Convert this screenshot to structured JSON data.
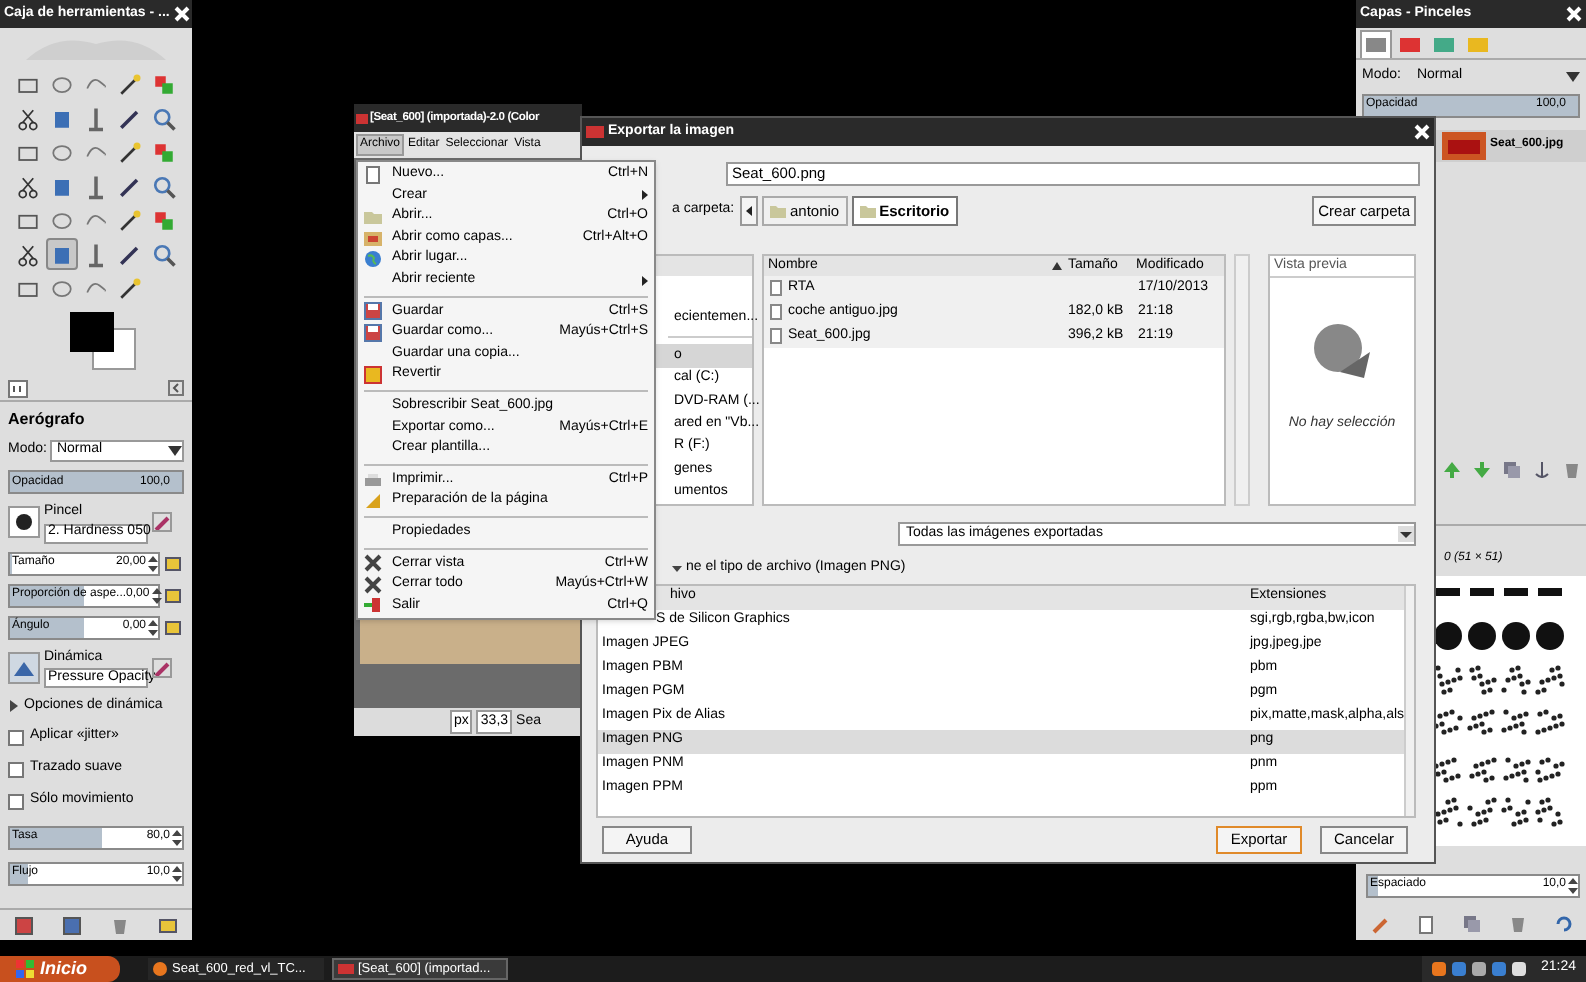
{
  "toolbox": {
    "title": "Caja de herramientas - ...",
    "tools": [
      {
        "selected": false
      },
      {
        "selected": false
      },
      {
        "selected": false
      },
      {
        "selected": false
      },
      {
        "selected": false
      },
      {
        "selected": false
      },
      {
        "selected": false
      },
      {
        "selected": false
      },
      {
        "selected": false
      },
      {
        "selected": false
      },
      {
        "selected": false
      },
      {
        "selected": false
      },
      {
        "selected": false
      },
      {
        "selected": false
      },
      {
        "selected": false
      },
      {
        "selected": false
      },
      {
        "selected": false
      },
      {
        "selected": false
      },
      {
        "selected": false
      },
      {
        "selected": false
      },
      {
        "selected": false
      },
      {
        "selected": false
      },
      {
        "selected": false
      },
      {
        "selected": false
      },
      {
        "selected": false
      },
      {
        "selected": false
      },
      {
        "selected": true
      },
      {
        "selected": false
      },
      {
        "selected": false
      },
      {
        "selected": false
      },
      {
        "selected": false
      },
      {
        "selected": false
      },
      {
        "selected": false
      },
      {
        "selected": false
      }
    ],
    "options": {
      "title": "Aerógrafo",
      "mode": {
        "label": "Modo:",
        "value": "Normal"
      },
      "opacity": {
        "label": "Opacidad",
        "value": "100,0",
        "level": 1
      },
      "brush": {
        "label": "Pincel",
        "value": "2. Hardness 050"
      },
      "params": [
        {
          "label": "Tamaño",
          "value": "20,00",
          "level": 0.02
        },
        {
          "label": "Proporción de aspe...",
          "value": "0,00",
          "level": 0.5
        },
        {
          "label": "Ángulo",
          "value": "0,00",
          "level": 0.5
        }
      ],
      "dynamics": {
        "label": "Dinámica",
        "value": "Pressure Opacity"
      },
      "dynamics_options": {
        "label": "Opciones de dinámica",
        "expanded": false
      },
      "checkboxes": [
        {
          "label": "Aplicar «jitter»",
          "checked": false
        },
        {
          "label": "Trazado suave",
          "checked": false
        },
        {
          "label": "Sólo movimiento",
          "checked": false
        }
      ],
      "rates": [
        {
          "label": "Tasa",
          "value": "80,0",
          "level": 0.53
        },
        {
          "label": "Flujo",
          "value": "10,0",
          "level": 0.1
        }
      ]
    }
  },
  "image_window": {
    "title": "[Seat_600] (importada)-2.0 (Color",
    "menus": [
      {
        "label": "Archivo",
        "selected": true
      },
      {
        "label": "Editar",
        "selected": false
      },
      {
        "label": "Seleccionar",
        "selected": false
      },
      {
        "label": "Vista",
        "selected": false
      }
    ],
    "unit": "px",
    "zoom": "33,3",
    "status": "Sea"
  },
  "file_menu": [
    {
      "kind": "item",
      "label": "Nuevo...",
      "shortcut": "Ctrl+N"
    },
    {
      "kind": "item",
      "label": "Crear",
      "submenu": true
    },
    {
      "kind": "item",
      "label": "Abrir...",
      "shortcut": "Ctrl+O"
    },
    {
      "kind": "item",
      "label": "Abrir como capas...",
      "shortcut": "Ctrl+Alt+O"
    },
    {
      "kind": "item",
      "label": "Abrir lugar..."
    },
    {
      "kind": "item",
      "label": "Abrir reciente",
      "submenu": true
    },
    {
      "kind": "separator"
    },
    {
      "kind": "item",
      "label": "Guardar",
      "shortcut": "Ctrl+S"
    },
    {
      "kind": "item",
      "label": "Guardar como...",
      "shortcut": "Mayús+Ctrl+S"
    },
    {
      "kind": "item",
      "label": "Guardar una copia..."
    },
    {
      "kind": "item",
      "label": "Revertir"
    },
    {
      "kind": "separator"
    },
    {
      "kind": "item",
      "label": "Sobrescribir Seat_600.jpg"
    },
    {
      "kind": "item",
      "label": "Exportar como...",
      "shortcut": "Mayús+Ctrl+E"
    },
    {
      "kind": "item",
      "label": "Crear plantilla..."
    },
    {
      "kind": "separator"
    },
    {
      "kind": "item",
      "label": "Imprimir...",
      "shortcut": "Ctrl+P"
    },
    {
      "kind": "item",
      "label": "Preparación de la página"
    },
    {
      "kind": "separator"
    },
    {
      "kind": "item",
      "label": "Propiedades"
    },
    {
      "kind": "separator"
    },
    {
      "kind": "item",
      "label": "Cerrar vista",
      "shortcut": "Ctrl+W"
    },
    {
      "kind": "item",
      "label": "Cerrar todo",
      "shortcut": "Mayús+Ctrl+W"
    },
    {
      "kind": "item",
      "label": "Salir",
      "shortcut": "Ctrl+Q"
    }
  ],
  "export_dialog": {
    "title": "Exportar la imagen",
    "name_value": "Seat_600.png",
    "folder_label": "a carpeta:",
    "path": [
      {
        "label": "antonio",
        "selected": false
      },
      {
        "label": "Escritorio",
        "selected": true
      }
    ],
    "create_folder": "Crear carpeta",
    "places": [
      {
        "label": "ecientemen...",
        "selected": false
      },
      {
        "label": "o",
        "selected": true
      },
      {
        "label": "cal (C:)",
        "selected": false
      },
      {
        "label": "DVD-RAM (...",
        "selected": false
      },
      {
        "label": "ared en \"Vb...",
        "selected": false
      },
      {
        "label": "R (F:)",
        "selected": false
      },
      {
        "label": "genes",
        "selected": false
      },
      {
        "label": "umentos",
        "selected": false
      }
    ],
    "file_columns": [
      "Nombre",
      "Tamaño",
      "Modificado"
    ],
    "files": [
      {
        "name": "RTA",
        "modified": "17/10/2013"
      },
      {
        "name": "coche antiguo.jpg",
        "size": "182,0 kB",
        "modified": "21:18"
      },
      {
        "name": "Seat_600.jpg",
        "size": "396,2 kB",
        "modified": "21:19"
      }
    ],
    "preview_label": "Vista previa",
    "preview_empty": "No hay selección",
    "filter": "Todas las imágenes exportadas",
    "type_expander": {
      "label": "ne el tipo de archivo (Imagen PNG)",
      "expanded": true
    },
    "type_columns": [
      "hivo",
      "Extensiones"
    ],
    "types": [
      {
        "name": "S de Silicon Graphics",
        "ext": "sgi,rgb,rgba,bw,icon",
        "selected": false
      },
      {
        "name": "Imagen JPEG",
        "ext": "jpg,jpeg,jpe",
        "selected": false
      },
      {
        "name": "Imagen PBM",
        "ext": "pbm",
        "selected": false
      },
      {
        "name": "Imagen PGM",
        "ext": "pgm",
        "selected": false
      },
      {
        "name": "Imagen Pix de Alias",
        "ext": "pix,matte,mask,alpha,als",
        "selected": false
      },
      {
        "name": "Imagen PNG",
        "ext": "png",
        "selected": true
      },
      {
        "name": "Imagen PNM",
        "ext": "pnm",
        "selected": false
      },
      {
        "name": "Imagen PPM",
        "ext": "ppm",
        "selected": false
      }
    ],
    "help": "Ayuda",
    "export": "Exportar",
    "cancel": "Cancelar"
  },
  "right_panel": {
    "title": "Capas - Pinceles",
    "tabs": [
      {
        "selected": true
      },
      {
        "selected": false
      },
      {
        "selected": false
      },
      {
        "selected": false
      }
    ],
    "mode": {
      "label": "Modo:",
      "value": "Normal"
    },
    "opacity": {
      "label": "Opacidad",
      "value": "100,0",
      "level": 1
    },
    "layers": [
      {
        "name": "Seat_600.jpg"
      }
    ],
    "brush_info": "0 (51 × 51)",
    "spacing": {
      "label": "Espaciado",
      "value": "10,0",
      "level": 0.05
    }
  },
  "taskbar": {
    "start": "Inicio",
    "tasks": [
      {
        "label": "Seat_600_red_vl_TC...",
        "selected": false
      },
      {
        "label": "[Seat_600] (importad...",
        "selected": true
      }
    ],
    "clock": "21:24"
  }
}
